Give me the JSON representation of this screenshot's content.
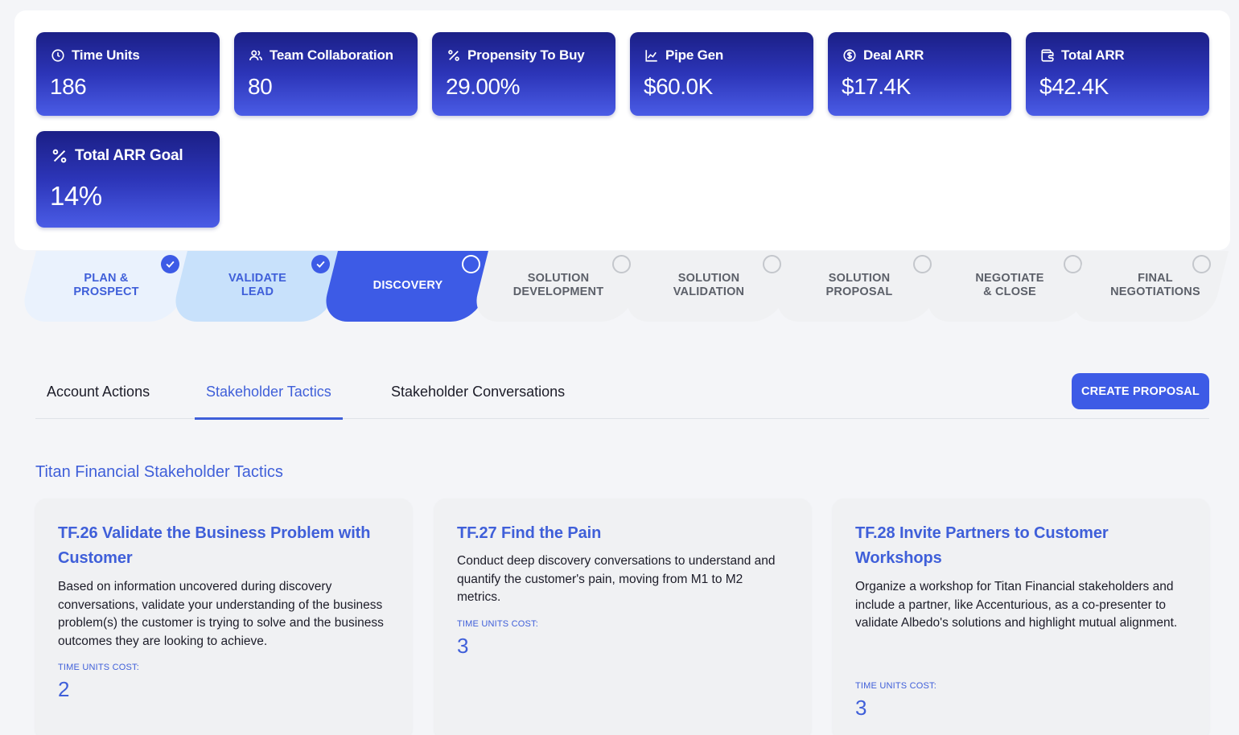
{
  "metrics": [
    {
      "label": "Time Units",
      "value": "186",
      "icon": "clock-icon"
    },
    {
      "label": "Team Collaboration",
      "value": "80",
      "icon": "users-icon"
    },
    {
      "label": "Propensity To Buy",
      "value": "29.00%",
      "icon": "percent-icon"
    },
    {
      "label": "Pipe Gen",
      "value": "$60.0K",
      "icon": "line-chart-icon"
    },
    {
      "label": "Deal ARR",
      "value": "$17.4K",
      "icon": "dollar-circle-icon"
    },
    {
      "label": "Total ARR",
      "value": "$42.4K",
      "icon": "wallet-icon"
    },
    {
      "label": "Total ARR Goal",
      "value": "14%",
      "icon": "percent-icon"
    }
  ],
  "stages": [
    {
      "line1": "PLAN &",
      "line2": "PROSPECT",
      "state": "complete"
    },
    {
      "line1": "VALIDATE",
      "line2": "LEAD",
      "state": "complete"
    },
    {
      "line1": "DISCOVERY",
      "line2": "",
      "state": "current"
    },
    {
      "line1": "SOLUTION",
      "line2": "DEVELOPMENT",
      "state": "pending"
    },
    {
      "line1": "SOLUTION",
      "line2": "VALIDATION",
      "state": "pending"
    },
    {
      "line1": "SOLUTION",
      "line2": "PROPOSAL",
      "state": "pending"
    },
    {
      "line1": "NEGOTIATE",
      "line2": "& CLOSE",
      "state": "pending"
    },
    {
      "line1": "FINAL",
      "line2": "NEGOTIATIONS",
      "state": "pending"
    }
  ],
  "tabs": [
    "Account Actions",
    "Stakeholder Tactics",
    "Stakeholder Conversations"
  ],
  "active_tab": "Stakeholder Tactics",
  "create_button": "CREATE PROPOSAL",
  "section_title": "Titan Financial Stakeholder Tactics",
  "tactics": [
    {
      "title": "TF.26 Validate the Business Problem with Customer",
      "description": "Based on information uncovered during discovery conversations, validate your understanding of the business problem(s) the customer is trying to solve and the business outcomes they are looking to achieve.",
      "cost_label": "TIME UNITS COST:",
      "cost": "2"
    },
    {
      "title": "TF.27 Find the Pain",
      "description": "Conduct deep discovery conversations to understand and quantify the customer's pain, moving from M1 to M2 metrics.",
      "cost_label": "TIME UNITS COST:",
      "cost": "3"
    },
    {
      "title": "TF.28 Invite Partners to Customer Workshops",
      "description": "Organize a workshop for Titan Financial stakeholders and include a partner, like Accenturious, as a co-presenter to validate Albedo's solutions and highlight mutual alignment.",
      "cost_label": "TIME UNITS COST:",
      "cost": "3"
    }
  ],
  "colors": {
    "accent": "#3d5be6",
    "card_dark": "#1b1f86",
    "card_light": "#4a5ce6",
    "text_blue": "#3f5fd9"
  }
}
